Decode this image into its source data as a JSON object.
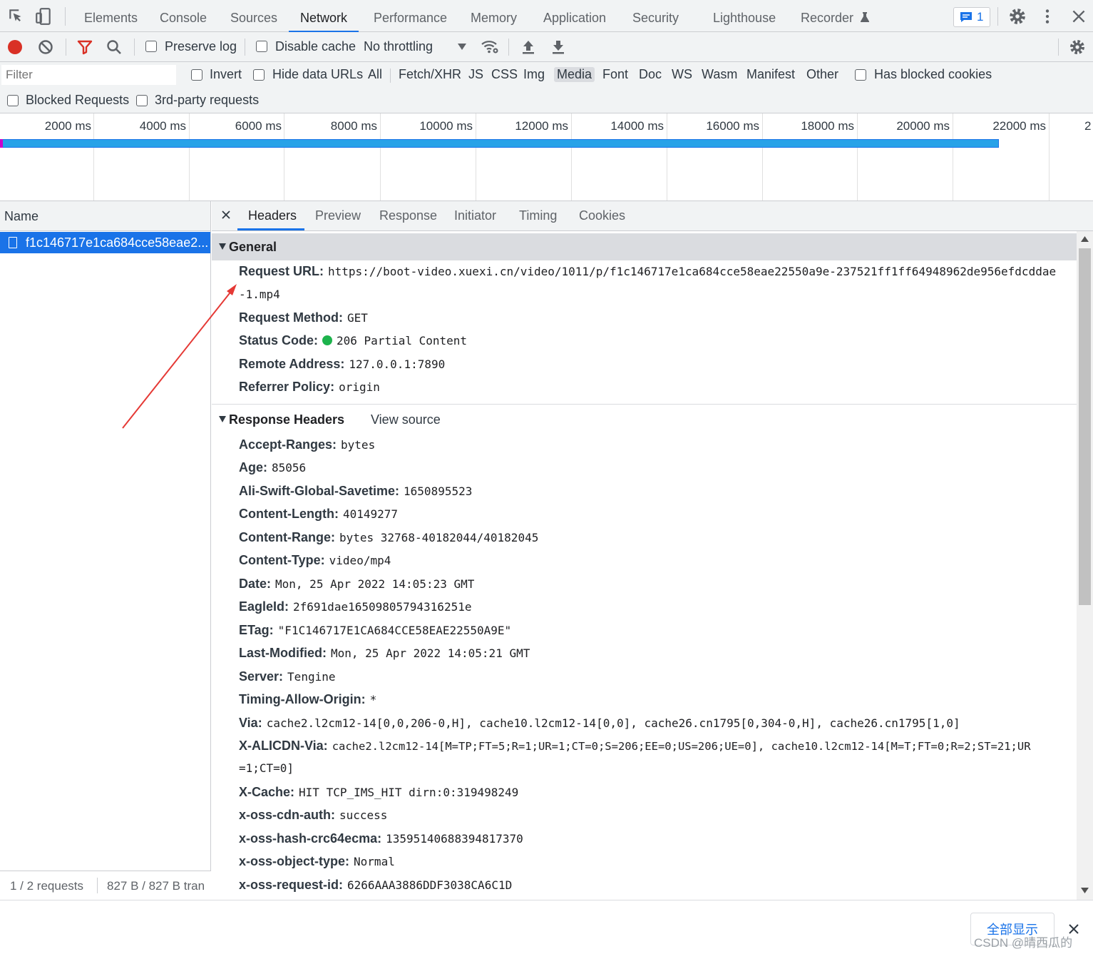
{
  "tabs": [
    "Elements",
    "Console",
    "Sources",
    "Network",
    "Performance",
    "Memory",
    "Application",
    "Security",
    "Lighthouse",
    "Recorder"
  ],
  "issues_count": "1",
  "toolbar": {
    "preserve_log": "Preserve log",
    "disable_cache": "Disable cache",
    "throttling": "No throttling"
  },
  "filter": {
    "placeholder": "Filter",
    "invert": "Invert",
    "hide_data_urls": "Hide data URLs",
    "types": [
      "All",
      "Fetch/XHR",
      "JS",
      "CSS",
      "Img",
      "Media",
      "Font",
      "Doc",
      "WS",
      "Wasm",
      "Manifest",
      "Other"
    ],
    "selected_type": "Media",
    "has_blocked_cookies": "Has blocked cookies",
    "blocked_requests": "Blocked Requests",
    "third_party": "3rd-party requests"
  },
  "timeline": {
    "ticks": [
      "2000 ms",
      "4000 ms",
      "6000 ms",
      "8000 ms",
      "10000 ms",
      "12000 ms",
      "14000 ms",
      "16000 ms",
      "18000 ms",
      "20000 ms",
      "22000 ms"
    ],
    "clipped_tick": "2"
  },
  "requests": {
    "column": "Name",
    "items": [
      {
        "name": "f1c146717e1ca684cce58eae2..."
      }
    ],
    "summary_count": "1 / 2 requests",
    "summary_size": "827 B / 827 B tran"
  },
  "detail_tabs": [
    "Headers",
    "Preview",
    "Response",
    "Initiator",
    "Timing",
    "Cookies"
  ],
  "general": {
    "title": "General",
    "rows": [
      {
        "k": "Request URL:",
        "v": "https://boot-video.xuexi.cn/video/1011/p/f1c146717e1ca684cce58eae22550a9e-237521ff1ff64948962de956efdcddae"
      },
      {
        "k": "",
        "v": "-1.mp4"
      },
      {
        "k": "Request Method:",
        "v": "GET"
      },
      {
        "k": "Status Code:",
        "v": "206 Partial Content"
      },
      {
        "k": "Remote Address:",
        "v": "127.0.0.1:7890"
      },
      {
        "k": "Referrer Policy:",
        "v": "origin"
      }
    ]
  },
  "response_headers": {
    "title": "Response Headers",
    "view_source": "View source",
    "rows": [
      {
        "k": "Accept-Ranges:",
        "v": "bytes"
      },
      {
        "k": "Age:",
        "v": "85056"
      },
      {
        "k": "Ali-Swift-Global-Savetime:",
        "v": "1650895523"
      },
      {
        "k": "Content-Length:",
        "v": "40149277"
      },
      {
        "k": "Content-Range:",
        "v": "bytes 32768-40182044/40182045"
      },
      {
        "k": "Content-Type:",
        "v": "video/mp4"
      },
      {
        "k": "Date:",
        "v": "Mon, 25 Apr 2022 14:05:23 GMT"
      },
      {
        "k": "EagleId:",
        "v": "2f691dae16509805794316251e"
      },
      {
        "k": "ETag:",
        "v": "\"F1C146717E1CA684CCE58EAE22550A9E\""
      },
      {
        "k": "Last-Modified:",
        "v": "Mon, 25 Apr 2022 14:05:21 GMT"
      },
      {
        "k": "Server:",
        "v": "Tengine"
      },
      {
        "k": "Timing-Allow-Origin:",
        "v": "*"
      },
      {
        "k": "Via:",
        "v": "cache2.l2cm12-14[0,0,206-0,H], cache10.l2cm12-14[0,0], cache26.cn1795[0,304-0,H], cache26.cn1795[1,0]"
      },
      {
        "k": "X-ALICDN-Via:",
        "v": "cache2.l2cm12-14[M=TP;FT=5;R=1;UR=1;CT=0;S=206;EE=0;US=206;UE=0], cache10.l2cm12-14[M=T;FT=0;R=2;ST=21;UR"
      },
      {
        "k": "",
        "v": "=1;CT=0]"
      },
      {
        "k": "X-Cache:",
        "v": "HIT TCP_IMS_HIT dirn:0:319498249"
      },
      {
        "k": "x-oss-cdn-auth:",
        "v": "success"
      },
      {
        "k": "x-oss-hash-crc64ecma:",
        "v": "13595140688394817370"
      },
      {
        "k": "x-oss-object-type:",
        "v": "Normal"
      },
      {
        "k": "x-oss-request-id:",
        "v": "6266AAA3886DDF3038CA6C1D"
      }
    ]
  },
  "bottom": {
    "show_all": "全部显示",
    "watermark": "CSDN @晴西瓜的"
  },
  "colors": {
    "accent": "#1a73e8",
    "record": "#d93025",
    "status_ok": "#1db34c",
    "arrow": "#e53935"
  }
}
